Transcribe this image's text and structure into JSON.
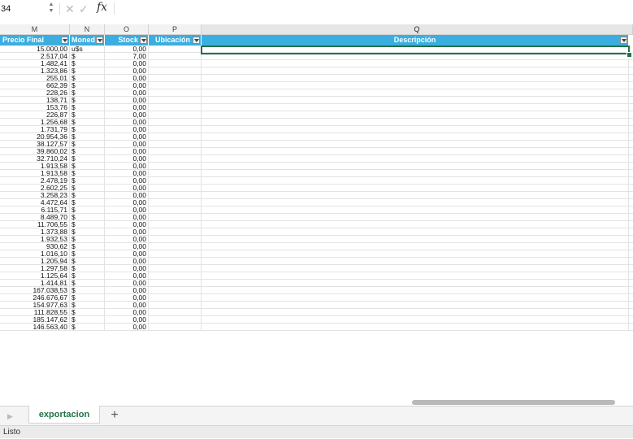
{
  "formula_bar": {
    "name_box": "34",
    "cancel_glyph": "✕",
    "enter_glyph": "✓",
    "fx_label": "fx",
    "stepper_up": "▲",
    "stepper_down": "▼"
  },
  "columns": [
    "M",
    "N",
    "O",
    "P",
    "Q"
  ],
  "table_headers": [
    "Precio Final",
    "Moned",
    "Stock",
    "Ubicación",
    "Descripción"
  ],
  "rows": [
    {
      "precio": "15.000,00",
      "moneda": "u$s",
      "stock": "0,00"
    },
    {
      "precio": "2.517,04",
      "moneda": "$",
      "stock": "7,00"
    },
    {
      "precio": "1.482,41",
      "moneda": "$",
      "stock": "0,00"
    },
    {
      "precio": "1.323,86",
      "moneda": "$",
      "stock": "0,00"
    },
    {
      "precio": "255,01",
      "moneda": "$",
      "stock": "0,00"
    },
    {
      "precio": "662,39",
      "moneda": "$",
      "stock": "0,00"
    },
    {
      "precio": "228,26",
      "moneda": "$",
      "stock": "0,00"
    },
    {
      "precio": "138,71",
      "moneda": "$",
      "stock": "0,00"
    },
    {
      "precio": "153,76",
      "moneda": "$",
      "stock": "0,00"
    },
    {
      "precio": "226,87",
      "moneda": "$",
      "stock": "0,00"
    },
    {
      "precio": "1.256,68",
      "moneda": "$",
      "stock": "0,00"
    },
    {
      "precio": "1.731,79",
      "moneda": "$",
      "stock": "0,00"
    },
    {
      "precio": "20.954,36",
      "moneda": "$",
      "stock": "0,00"
    },
    {
      "precio": "38.127,57",
      "moneda": "$",
      "stock": "0,00"
    },
    {
      "precio": "39.860,02",
      "moneda": "$",
      "stock": "0,00"
    },
    {
      "precio": "32.710,24",
      "moneda": "$",
      "stock": "0,00"
    },
    {
      "precio": "1.913,58",
      "moneda": "$",
      "stock": "0,00"
    },
    {
      "precio": "1.913,58",
      "moneda": "$",
      "stock": "0,00"
    },
    {
      "precio": "2.478,19",
      "moneda": "$",
      "stock": "0,00"
    },
    {
      "precio": "2.602,25",
      "moneda": "$",
      "stock": "0,00"
    },
    {
      "precio": "3.258,23",
      "moneda": "$",
      "stock": "0,00"
    },
    {
      "precio": "4.472,64",
      "moneda": "$",
      "stock": "0,00"
    },
    {
      "precio": "6.115,71",
      "moneda": "$",
      "stock": "0,00"
    },
    {
      "precio": "8.489,70",
      "moneda": "$",
      "stock": "0,00"
    },
    {
      "precio": "11.706,55",
      "moneda": "$",
      "stock": "0,00"
    },
    {
      "precio": "1.373,88",
      "moneda": "$",
      "stock": "0,00"
    },
    {
      "precio": "1.932,53",
      "moneda": "$",
      "stock": "0,00"
    },
    {
      "precio": "930,62",
      "moneda": "$",
      "stock": "0,00"
    },
    {
      "precio": "1.016,10",
      "moneda": "$",
      "stock": "0,00"
    },
    {
      "precio": "1.205,94",
      "moneda": "$",
      "stock": "0,00"
    },
    {
      "precio": "1.297,58",
      "moneda": "$",
      "stock": "0,00"
    },
    {
      "precio": "1.125,64",
      "moneda": "$",
      "stock": "0,00"
    },
    {
      "precio": "1.414,81",
      "moneda": "$",
      "stock": "0,00"
    },
    {
      "precio": "167.038,53",
      "moneda": "$",
      "stock": "0,00"
    },
    {
      "precio": "246.676,67",
      "moneda": "$",
      "stock": "0,00"
    },
    {
      "precio": "154.977,63",
      "moneda": "$",
      "stock": "0,00"
    },
    {
      "precio": "111.828,55",
      "moneda": "$",
      "stock": "0,00"
    },
    {
      "precio": "185.147,62",
      "moneda": "$",
      "stock": "0,00"
    },
    {
      "precio": "146.563,40",
      "moneda": "$",
      "stock": "0,00"
    }
  ],
  "sheet_tabs": {
    "nav_glyph": "▶",
    "active": "exportacion",
    "add_glyph": "+"
  },
  "status": "Listo",
  "colors": {
    "table_header": "#3aaee0",
    "selection": "#217346",
    "active_tab_text": "#217346"
  }
}
